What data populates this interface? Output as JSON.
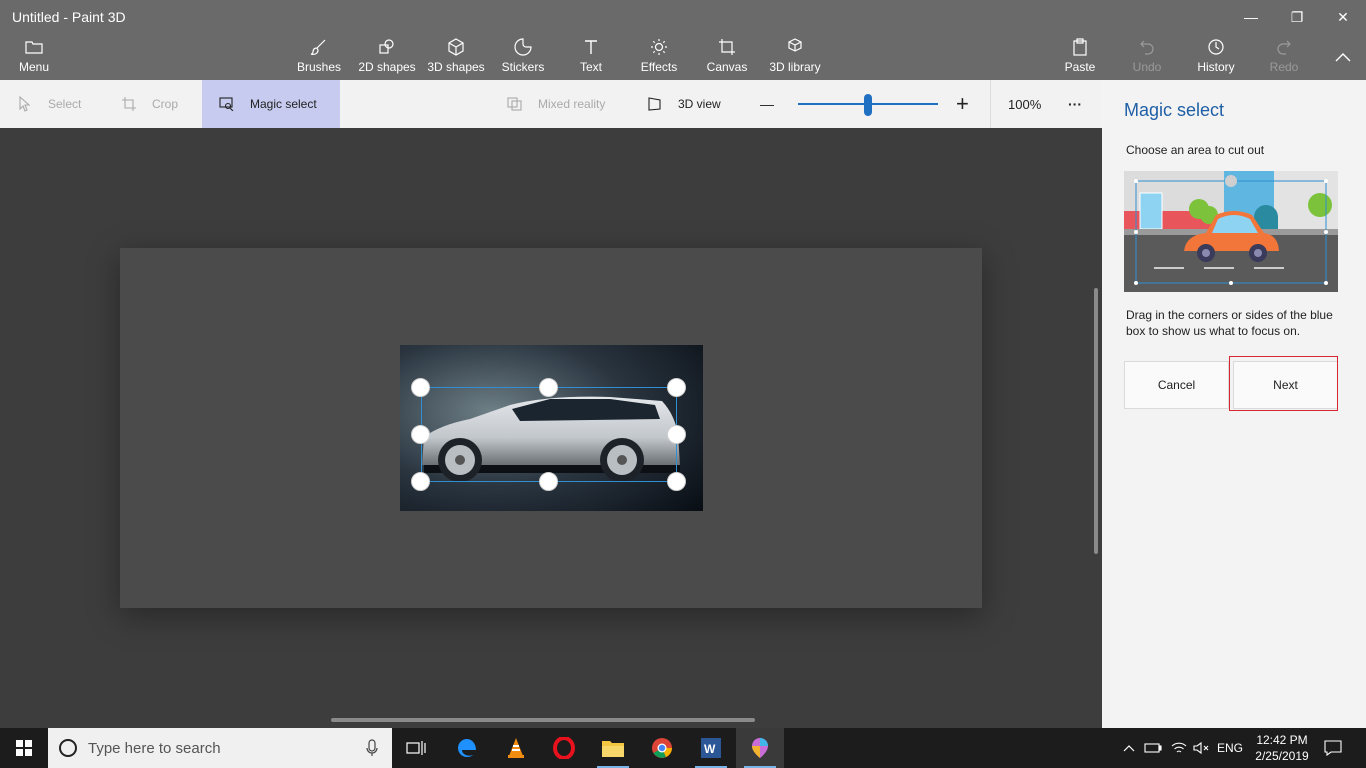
{
  "window": {
    "title": "Untitled - Paint 3D",
    "controls": {
      "minimize": "—",
      "maximize": "❐",
      "close": "✕"
    }
  },
  "ribbon": {
    "menu": "Menu",
    "tools": [
      "Brushes",
      "2D shapes",
      "3D shapes",
      "Stickers",
      "Text",
      "Effects",
      "Canvas",
      "3D library"
    ],
    "right": {
      "paste": "Paste",
      "undo": "Undo",
      "history": "History",
      "redo": "Redo"
    }
  },
  "toolbar": {
    "select": "Select",
    "crop": "Crop",
    "magic_select": "Magic select",
    "mixed_reality": "Mixed reality",
    "view_3d": "3D view",
    "zoom_minus": "—",
    "zoom_plus": "+",
    "zoom_level": "100%",
    "zoom_fraction": 0.5,
    "more": "···"
  },
  "panel": {
    "title": "Magic select",
    "subtitle": "Choose an area to cut out",
    "description": "Drag in the corners or sides of the blue box to show us what to focus on.",
    "cancel": "Cancel",
    "next": "Next"
  },
  "taskbar": {
    "search_placeholder": "Type here to search",
    "apps": [
      "task-view",
      "edge",
      "vlc",
      "opera",
      "file-explorer",
      "chrome",
      "word",
      "paint-3d"
    ],
    "tray": {
      "lang": "ENG",
      "time": "12:42 PM",
      "date": "2/25/2019"
    }
  },
  "colors": {
    "accent": "#1f5fa6",
    "selection": "#2f8fd1",
    "highlight": "#d7282f",
    "active_tool": "#c6cbef"
  }
}
